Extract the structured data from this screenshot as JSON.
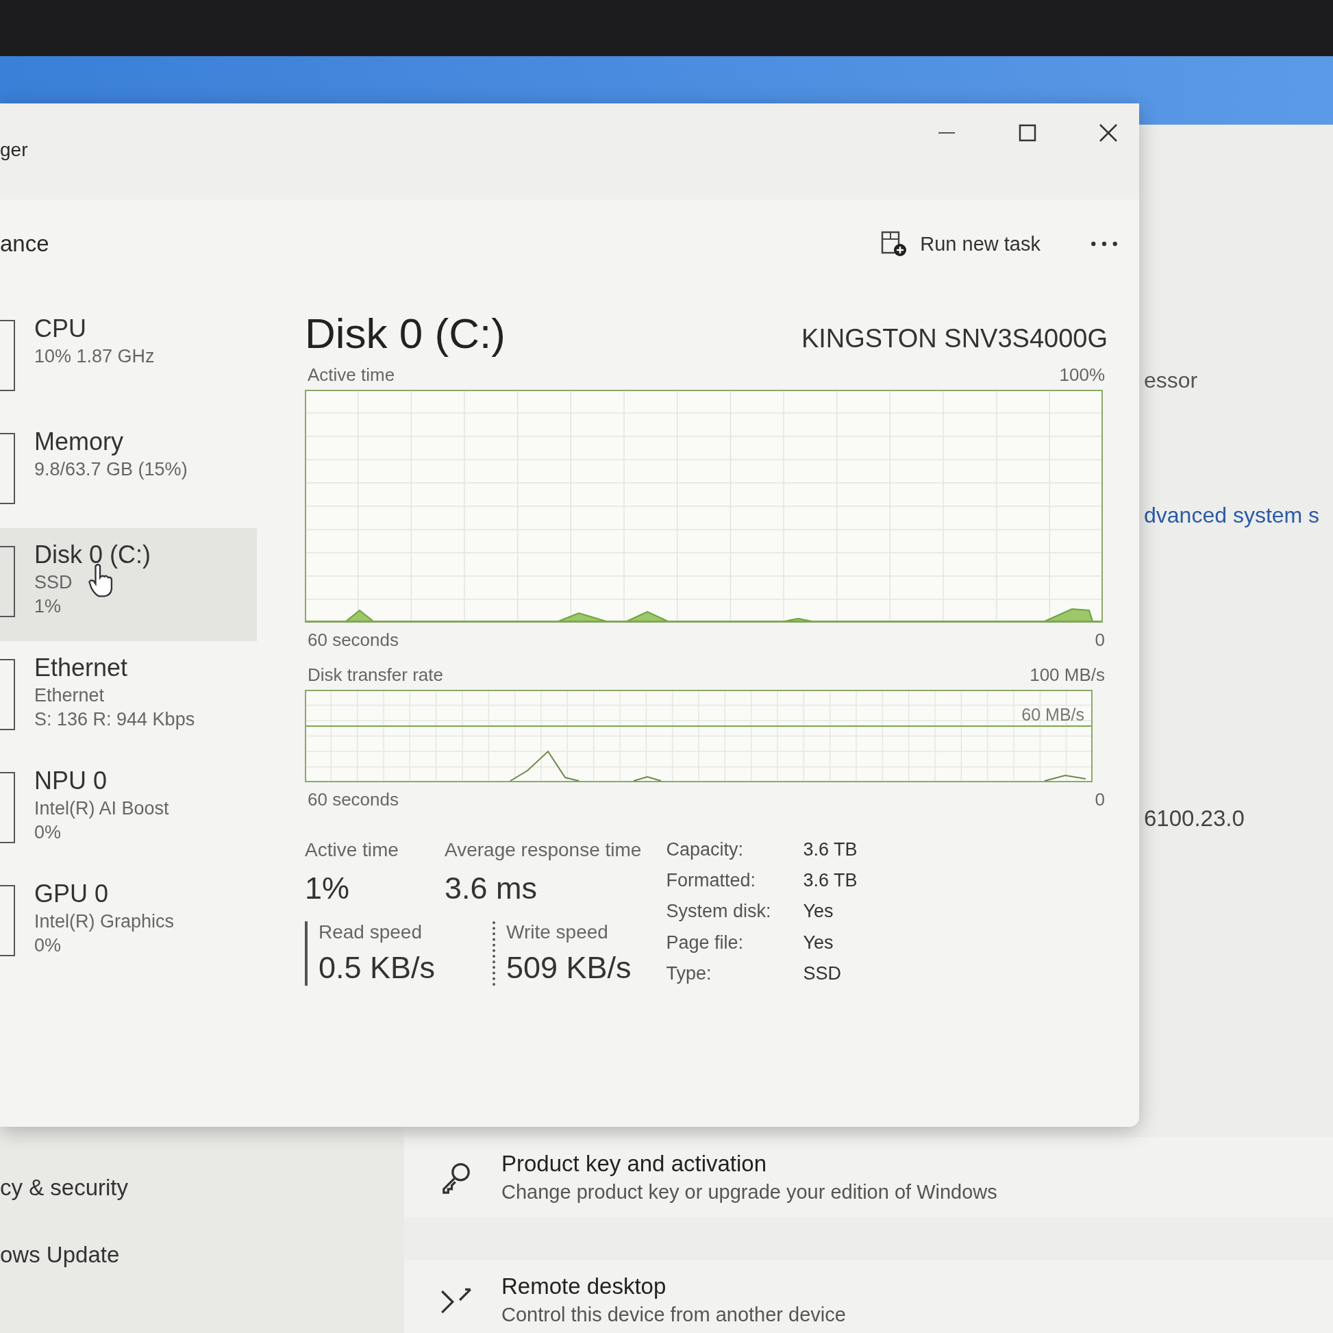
{
  "window": {
    "title": "ger",
    "section": "ance",
    "run_task": "Run new task"
  },
  "sidebar": [
    {
      "name": "CPU",
      "lines": [
        "10% 1.87 GHz"
      ],
      "selected": false
    },
    {
      "name": "Memory",
      "lines": [
        "9.8/63.7 GB (15%)"
      ],
      "selected": false
    },
    {
      "name": "Disk 0 (C:)",
      "lines": [
        "SSD",
        "1%"
      ],
      "selected": true
    },
    {
      "name": "Ethernet",
      "lines": [
        "Ethernet",
        "S: 136 R: 944 Kbps"
      ],
      "selected": false
    },
    {
      "name": "NPU 0",
      "lines": [
        "Intel(R) AI Boost",
        "0%"
      ],
      "selected": false
    },
    {
      "name": "GPU 0",
      "lines": [
        "Intel(R) Graphics",
        "0%"
      ],
      "selected": false
    }
  ],
  "disk": {
    "title": "Disk 0 (C:)",
    "model": "KINGSTON SNV3S4000G",
    "active_chart": {
      "label": "Active time",
      "max": "100%",
      "span": "60 seconds",
      "min": "0"
    },
    "transfer_chart": {
      "label": "Disk transfer rate",
      "max": "100 MB/s",
      "mid": "60 MB/s",
      "span": "60 seconds",
      "min": "0"
    },
    "stats": [
      {
        "label": "Active time",
        "value": "1%"
      },
      {
        "label": "Average response time",
        "value": "3.6 ms"
      }
    ],
    "speeds": [
      {
        "kind": "read",
        "label": "Read speed",
        "value": "0.5 KB/s"
      },
      {
        "kind": "write",
        "label": "Write speed",
        "value": "509 KB/s"
      }
    ],
    "properties": [
      {
        "label": "Capacity:",
        "value": "3.6 TB"
      },
      {
        "label": "Formatted:",
        "value": "3.6 TB"
      },
      {
        "label": "System disk:",
        "value": "Yes"
      },
      {
        "label": "Page file:",
        "value": "Yes"
      },
      {
        "label": "Type:",
        "value": "SSD"
      }
    ]
  },
  "background": {
    "right_texts": [
      "essor",
      "dvanced system s",
      "6100.23.0"
    ],
    "nav": [
      "cy & security",
      "ows Update"
    ],
    "cards": [
      {
        "kind": "key",
        "title": "Product key and activation",
        "subtitle": "Change product key or upgrade your edition of Windows"
      },
      {
        "kind": "remote",
        "title": "Remote desktop",
        "subtitle": "Control this device from another device"
      }
    ]
  }
}
